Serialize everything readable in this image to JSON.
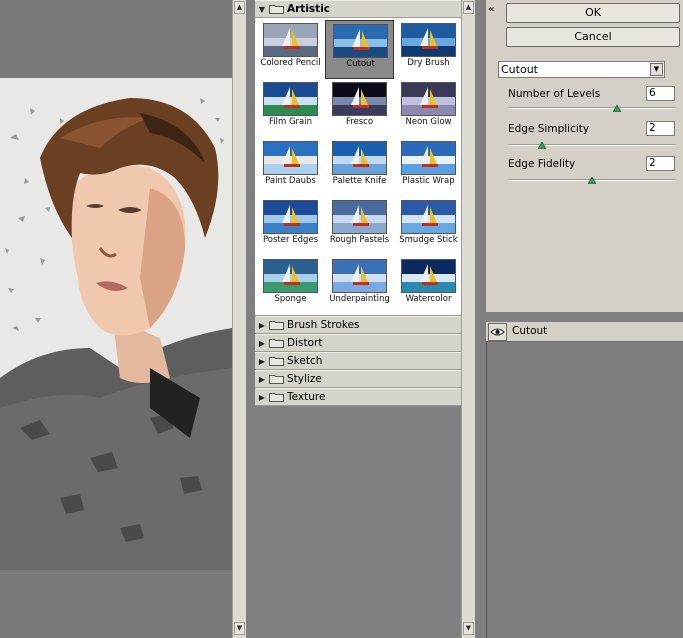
{
  "gallery": {
    "categories": [
      {
        "name": "Artistic",
        "expanded": true
      },
      {
        "name": "Brush Strokes",
        "expanded": false
      },
      {
        "name": "Distort",
        "expanded": false
      },
      {
        "name": "Sketch",
        "expanded": false
      },
      {
        "name": "Stylize",
        "expanded": false
      },
      {
        "name": "Texture",
        "expanded": false
      }
    ],
    "thumbnails": [
      {
        "label": "Colored Pencil"
      },
      {
        "label": "Cutout",
        "selected": true
      },
      {
        "label": "Dry Brush"
      },
      {
        "label": "Film Grain"
      },
      {
        "label": "Fresco"
      },
      {
        "label": "Neon Glow"
      },
      {
        "label": "Paint Daubs"
      },
      {
        "label": "Palette Knife"
      },
      {
        "label": "Plastic Wrap"
      },
      {
        "label": "Poster Edges"
      },
      {
        "label": "Rough Pastels"
      },
      {
        "label": "Smudge Stick"
      },
      {
        "label": "Sponge"
      },
      {
        "label": "Underpainting"
      },
      {
        "label": "Watercolor"
      }
    ]
  },
  "buttons": {
    "ok": "OK",
    "cancel": "Cancel"
  },
  "filter": {
    "selected": "Cutout",
    "params": [
      {
        "label": "Number of Levels",
        "value": "6",
        "slider_fraction": 0.65
      },
      {
        "label": "Edge Simplicity",
        "value": "2",
        "slider_fraction": 0.2
      },
      {
        "label": "Edge Fidelity",
        "value": "2",
        "slider_fraction": 0.5
      }
    ]
  },
  "layers": {
    "items": [
      {
        "name": "Cutout",
        "visible": true
      }
    ]
  },
  "colors": {
    "panel": "#d4d0c8",
    "background": "#808080",
    "selection": "#8a8a8a"
  },
  "icons": [
    "collapse-icon",
    "folder-icon",
    "expand-triangle-icon",
    "eye-icon",
    "dropdown-arrow-icon"
  ]
}
